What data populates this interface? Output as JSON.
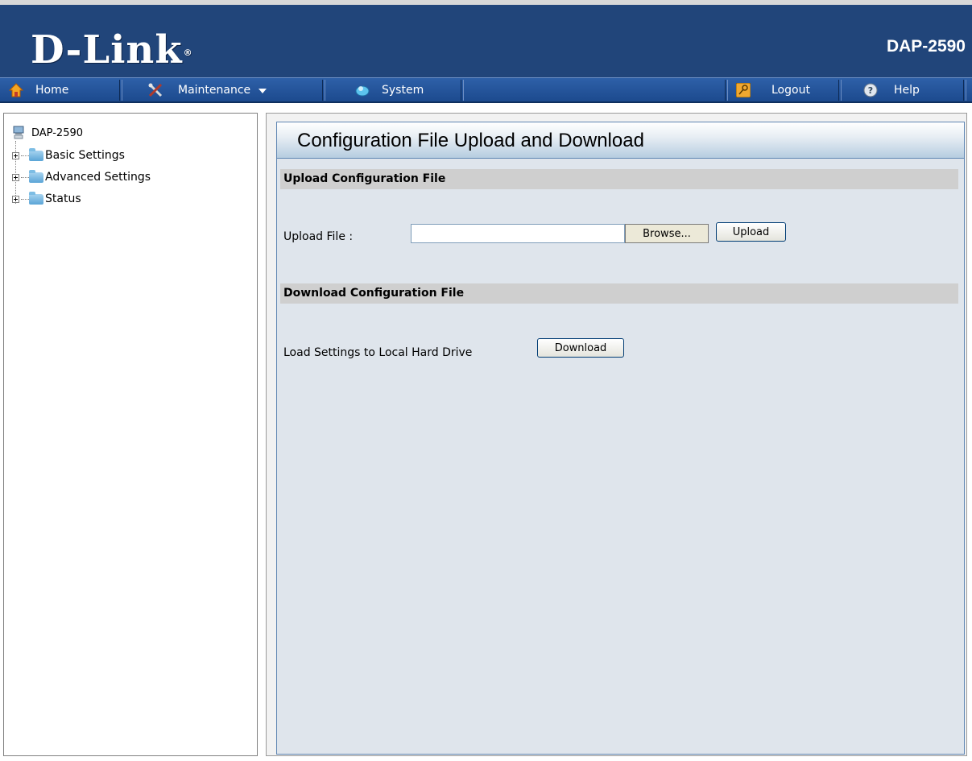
{
  "header": {
    "logo_text": "D-Link",
    "logo_mark": "®",
    "model": "DAP-2590"
  },
  "nav": {
    "items": [
      {
        "label": "Home",
        "icon": "home-icon"
      },
      {
        "label": "Maintenance",
        "icon": "tools-icon",
        "has_dropdown": true
      },
      {
        "label": "System",
        "icon": "system-icon"
      },
      {
        "label": "Logout",
        "icon": "key-icon"
      },
      {
        "label": "Help",
        "icon": "help-icon"
      }
    ]
  },
  "sidebar": {
    "root_label": "DAP-2590",
    "items": [
      {
        "label": "Basic Settings"
      },
      {
        "label": "Advanced Settings"
      },
      {
        "label": "Status"
      }
    ]
  },
  "main": {
    "title": "Configuration File Upload and Download",
    "upload": {
      "section_title": "Upload Configuration File",
      "label": "Upload File :",
      "file_value": "",
      "browse_label": "Browse...",
      "upload_label": "Upload"
    },
    "download": {
      "section_title": "Download Configuration File",
      "label": "Load Settings to Local Hard Drive",
      "download_label": "Download"
    }
  },
  "colors": {
    "header_bg": "#21457a",
    "navbar_bg": "#1c4a8e",
    "panel_bg": "#dfe5ec",
    "section_bar": "#cfcfcf"
  }
}
